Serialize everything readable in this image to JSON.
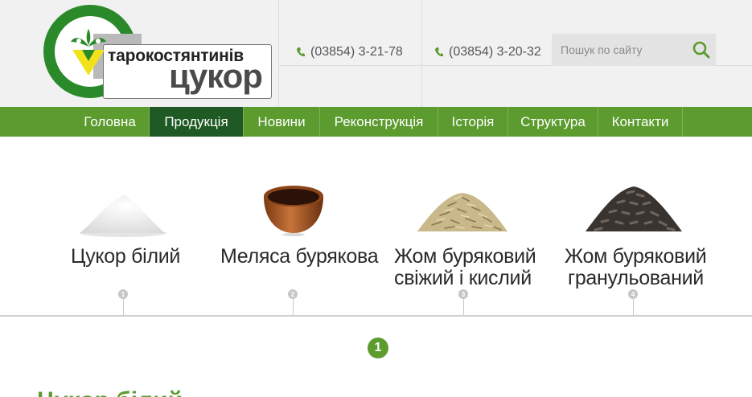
{
  "logo": {
    "line1": "тарокостянтинів",
    "line2": "цукор"
  },
  "header": {
    "phones": [
      "(03854) 3-21-78",
      "(03854) 3-20-32"
    ],
    "search_placeholder": "Пошук по сайту"
  },
  "nav": {
    "items": [
      {
        "label": "Головна",
        "active": false
      },
      {
        "label": "Продукція",
        "active": true
      },
      {
        "label": "Новини",
        "active": false
      },
      {
        "label": "Реконструкція",
        "active": false
      },
      {
        "label": "Історія",
        "active": false
      },
      {
        "label": "Структура",
        "active": false
      },
      {
        "label": "Контакти",
        "active": false
      }
    ]
  },
  "products": [
    {
      "title_line1": "Цукор білий",
      "title_line2": "",
      "marker": "1"
    },
    {
      "title_line1": "Меляса бурякова",
      "title_line2": "",
      "marker": "2"
    },
    {
      "title_line1": "Жом буряковий",
      "title_line2": "свіжий і кислий",
      "marker": "3"
    },
    {
      "title_line1": "Жом буряковий",
      "title_line2": "гранульований",
      "marker": "4"
    }
  ],
  "selected_marker": "1",
  "section_title": "Цукор білий",
  "colors": {
    "brand_green": "#5c9b2e",
    "nav_active": "#1f5a24",
    "logo_green": "#2a8a2a",
    "logo_yellow": "#f2e21c"
  }
}
